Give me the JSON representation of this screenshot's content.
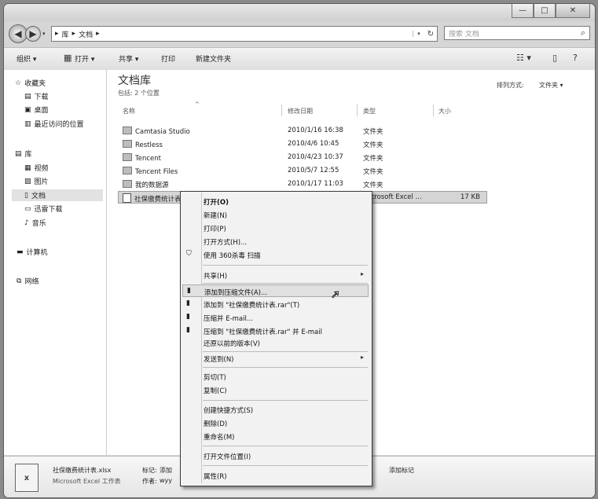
{
  "window": {
    "controls": {
      "minimize": "—",
      "maximize": "□",
      "close": "✕"
    }
  },
  "address_bar": {
    "breadcrumbs": [
      "▸",
      "库",
      "▸",
      "文档",
      "▸"
    ],
    "dropdown": "▾",
    "refresh": "↻"
  },
  "search": {
    "placeholder": "搜索 文档",
    "icon": "search-icon"
  },
  "toolbar": {
    "organize": "组织 ▾",
    "open": "打开 ▾",
    "share": "共享 ▾",
    "print": "打印",
    "new_folder": "新建文件夹"
  },
  "nav": {
    "favorites": {
      "label": "收藏夹",
      "items": [
        "下载",
        "桌面",
        "最近访问的位置"
      ]
    },
    "libraries": {
      "label": "库",
      "items": [
        "视频",
        "图片",
        "文档",
        "迅雷下载",
        "音乐"
      ]
    },
    "computer": "计算机",
    "network": "网络"
  },
  "library": {
    "title": "文档库",
    "subtitle": "包括: 2 个位置",
    "arrange_by_label": "排列方式:",
    "arrange_by_value": "文件夹 ▾"
  },
  "columns": {
    "name": "名称",
    "date": "修改日期",
    "type": "类型",
    "size": "大小"
  },
  "files": [
    {
      "name": "Camtasia Studio",
      "date": "2010/1/16 16:38",
      "type": "文件夹",
      "size": ""
    },
    {
      "name": "Restless",
      "date": "2010/4/6 10:45",
      "type": "文件夹",
      "size": ""
    },
    {
      "name": "Tencent",
      "date": "2010/4/23 10:37",
      "type": "文件夹",
      "size": ""
    },
    {
      "name": "Tencent Files",
      "date": "2010/5/7 12:55",
      "type": "文件夹",
      "size": ""
    },
    {
      "name": "我的数据源",
      "date": "2010/1/17 11:03",
      "type": "文件夹",
      "size": ""
    },
    {
      "name": "社保缴费统计表",
      "date": "",
      "type": "Microsoft Excel ...",
      "size": "17 KB"
    }
  ],
  "context_menu": {
    "items": [
      {
        "label": "打开(O)",
        "bold": true
      },
      {
        "label": "新建(N)"
      },
      {
        "label": "打印(P)"
      },
      {
        "label": "打开方式(H)..."
      },
      {
        "label": "使用 360杀毒 扫描",
        "icon": "shield"
      },
      {
        "label": "共享(H)",
        "submenu": "▸"
      },
      {
        "label": "添加到压缩文件(A)...",
        "icon": "archive"
      },
      {
        "label": "添加到 \"社保缴费统计表.rar\"(T)",
        "icon": "archive"
      },
      {
        "label": "压缩并 E-mail...",
        "icon": "archive"
      },
      {
        "label": "压缩到 \"社保缴费统计表.rar\" 并 E-mail",
        "icon": "archive"
      },
      {
        "label": "还原以前的版本(V)"
      },
      {
        "label": "发送到(N)",
        "submenu": "▸"
      },
      {
        "label": "剪切(T)"
      },
      {
        "label": "复制(C)"
      },
      {
        "label": "创建快捷方式(S)"
      },
      {
        "label": "删除(D)"
      },
      {
        "label": "重命名(M)"
      },
      {
        "label": "打开文件位置(I)"
      },
      {
        "label": "属性(R)"
      }
    ]
  },
  "details": {
    "filename": "社保缴费统计表.xlsx",
    "filetype": "Microsoft Excel 工作表",
    "tags_label": "标记:",
    "tags_value": "添加",
    "author_label": "作者:",
    "author_value": "wyy",
    "add_tag": "添加标记"
  }
}
